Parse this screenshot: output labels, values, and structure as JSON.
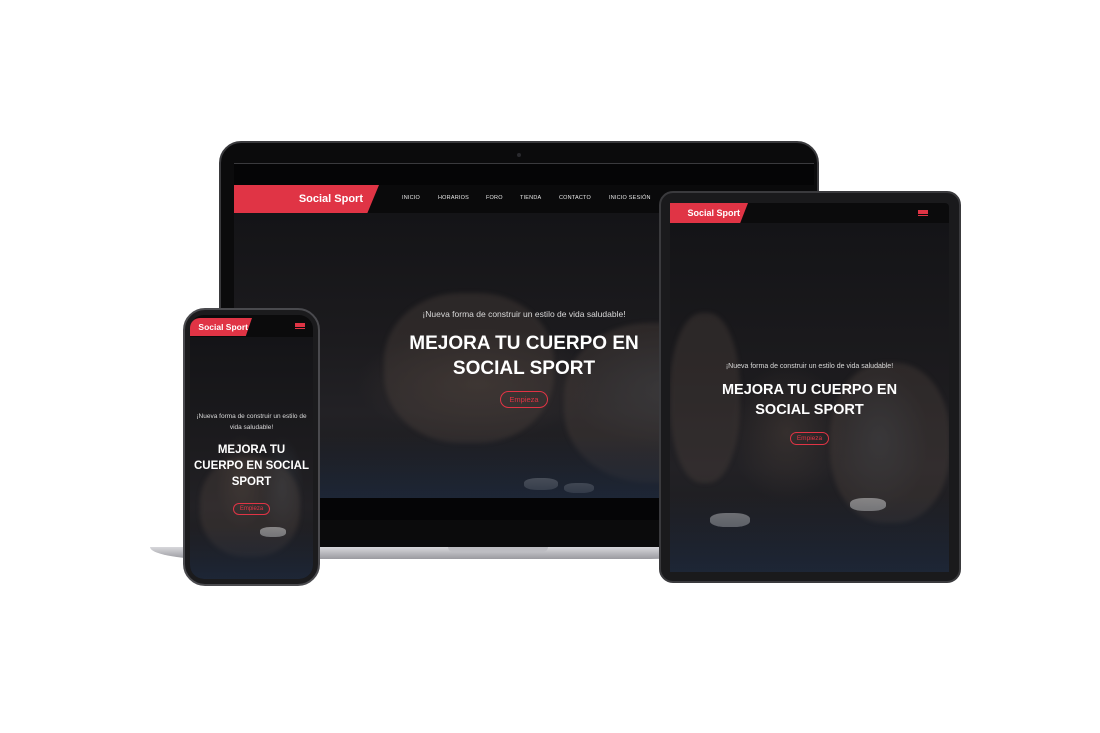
{
  "brand": "Social Sport",
  "nav": [
    "INICIO",
    "HORARIOS",
    "FORO",
    "TIENDA",
    "CONTACTO",
    "INICIO SESIÓN"
  ],
  "hero": {
    "tagline": "¡Nueva forma de construir un estilo de vida saludable!",
    "headline": "MEJORA TU CUERPO EN SOCIAL SPORT",
    "cta": "Empieza"
  },
  "icons": {
    "menu": "hamburger-menu-icon"
  },
  "colors": {
    "accent": "#e03445",
    "background": "#141417"
  }
}
